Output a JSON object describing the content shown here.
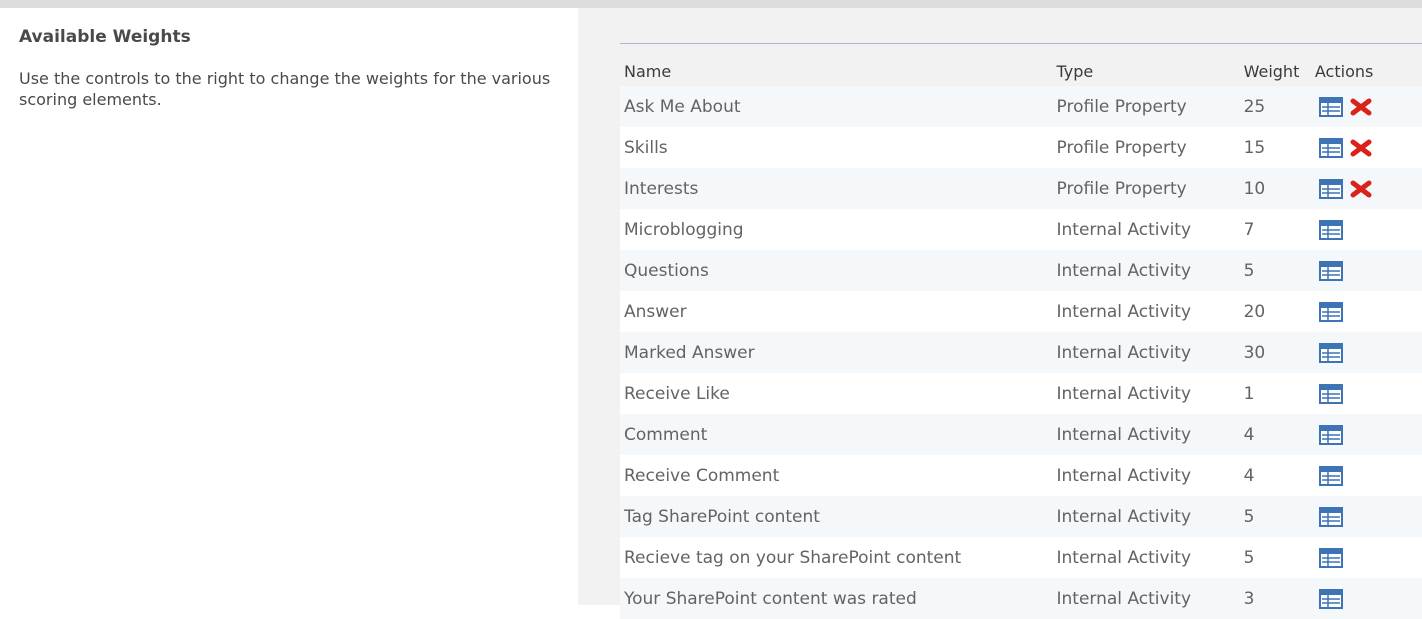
{
  "section": {
    "title": "Available Weights",
    "description": "Use the controls to the right to change the weights for the various scoring elements."
  },
  "table": {
    "headers": {
      "name": "Name",
      "type": "Type",
      "weight": "Weight",
      "actions": "Actions"
    },
    "rows": [
      {
        "name": "Ask Me About",
        "type": "Profile Property",
        "weight": "25",
        "actions": [
          "edit-icon",
          "delete-icon"
        ]
      },
      {
        "name": "Skills",
        "type": "Profile Property",
        "weight": "15",
        "actions": [
          "edit-icon",
          "delete-icon"
        ]
      },
      {
        "name": "Interests",
        "type": "Profile Property",
        "weight": "10",
        "actions": [
          "edit-icon",
          "delete-icon"
        ]
      },
      {
        "name": "Microblogging",
        "type": "Internal Activity",
        "weight": "7",
        "actions": [
          "edit-icon"
        ]
      },
      {
        "name": "Questions",
        "type": "Internal Activity",
        "weight": "5",
        "actions": [
          "edit-icon"
        ]
      },
      {
        "name": "Answer",
        "type": "Internal Activity",
        "weight": "20",
        "actions": [
          "edit-icon"
        ]
      },
      {
        "name": "Marked Answer",
        "type": "Internal Activity",
        "weight": "30",
        "actions": [
          "edit-icon"
        ]
      },
      {
        "name": "Receive Like",
        "type": "Internal Activity",
        "weight": "1",
        "actions": [
          "edit-icon"
        ]
      },
      {
        "name": "Comment",
        "type": "Internal Activity",
        "weight": "4",
        "actions": [
          "edit-icon"
        ]
      },
      {
        "name": "Receive Comment",
        "type": "Internal Activity",
        "weight": "4",
        "actions": [
          "edit-icon"
        ]
      },
      {
        "name": "Tag SharePoint content",
        "type": "Internal Activity",
        "weight": "5",
        "actions": [
          "edit-icon"
        ]
      },
      {
        "name": "Recieve tag on your SharePoint content",
        "type": "Internal Activity",
        "weight": "5",
        "actions": [
          "edit-icon"
        ]
      },
      {
        "name": "Your SharePoint content was rated",
        "type": "Internal Activity",
        "weight": "3",
        "actions": [
          "edit-icon"
        ]
      }
    ]
  },
  "colors": {
    "edit_icon": "#3e73b6",
    "delete_icon": "#d9231a",
    "row_alt": "#f4f8fb",
    "panel_bg": "#f2f2f2"
  }
}
